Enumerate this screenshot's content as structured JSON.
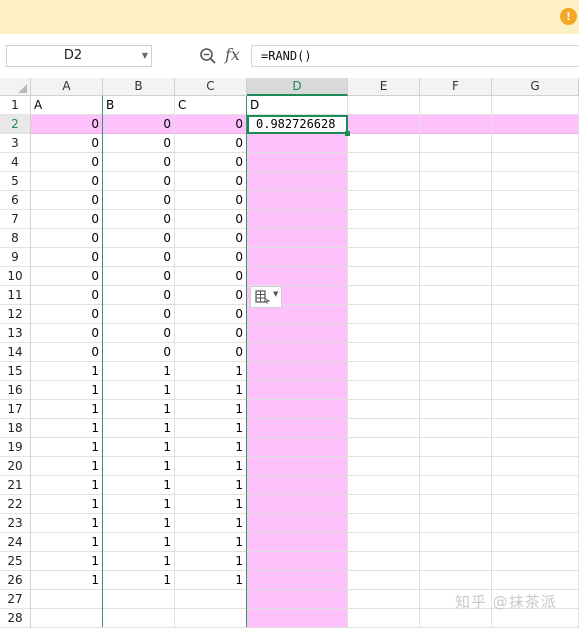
{
  "name_box": {
    "value": "D2"
  },
  "formula_bar": {
    "formula": "=RAND()",
    "fx_label": "fx"
  },
  "columns": [
    "A",
    "B",
    "C",
    "D",
    "E",
    "F",
    "G"
  ],
  "selected_column": "D",
  "selected_row": 2,
  "header_row": [
    "A",
    "B",
    "C",
    "D"
  ],
  "rows": [
    {
      "row": 2,
      "a": "0",
      "b": "0",
      "c": "0",
      "d": "0.982726628"
    },
    {
      "row": 3,
      "a": "0",
      "b": "0",
      "c": "0"
    },
    {
      "row": 4,
      "a": "0",
      "b": "0",
      "c": "0"
    },
    {
      "row": 5,
      "a": "0",
      "b": "0",
      "c": "0"
    },
    {
      "row": 6,
      "a": "0",
      "b": "0",
      "c": "0"
    },
    {
      "row": 7,
      "a": "0",
      "b": "0",
      "c": "0"
    },
    {
      "row": 8,
      "a": "0",
      "b": "0",
      "c": "0"
    },
    {
      "row": 9,
      "a": "0",
      "b": "0",
      "c": "0"
    },
    {
      "row": 10,
      "a": "0",
      "b": "0",
      "c": "0"
    },
    {
      "row": 11,
      "a": "0",
      "b": "0",
      "c": "0"
    },
    {
      "row": 12,
      "a": "0",
      "b": "0",
      "c": "0"
    },
    {
      "row": 13,
      "a": "0",
      "b": "0",
      "c": "0"
    },
    {
      "row": 14,
      "a": "0",
      "b": "0",
      "c": "0"
    },
    {
      "row": 15,
      "a": "1",
      "b": "1",
      "c": "1"
    },
    {
      "row": 16,
      "a": "1",
      "b": "1",
      "c": "1"
    },
    {
      "row": 17,
      "a": "1",
      "b": "1",
      "c": "1"
    },
    {
      "row": 18,
      "a": "1",
      "b": "1",
      "c": "1"
    },
    {
      "row": 19,
      "a": "1",
      "b": "1",
      "c": "1"
    },
    {
      "row": 20,
      "a": "1",
      "b": "1",
      "c": "1"
    },
    {
      "row": 21,
      "a": "1",
      "b": "1",
      "c": "1"
    },
    {
      "row": 22,
      "a": "1",
      "b": "1",
      "c": "1"
    },
    {
      "row": 23,
      "a": "1",
      "b": "1",
      "c": "1"
    },
    {
      "row": 24,
      "a": "1",
      "b": "1",
      "c": "1"
    },
    {
      "row": 25,
      "a": "1",
      "b": "1",
      "c": "1"
    },
    {
      "row": 26,
      "a": "1",
      "b": "1",
      "c": "1"
    },
    {
      "row": 27
    },
    {
      "row": 28
    }
  ],
  "notice": {
    "icon": "warning-icon",
    "color": "#f5a623"
  },
  "highlight_color": "#fdc1fb",
  "accent_color": "#1e8a57",
  "watermark": "知乎 @抹茶派"
}
